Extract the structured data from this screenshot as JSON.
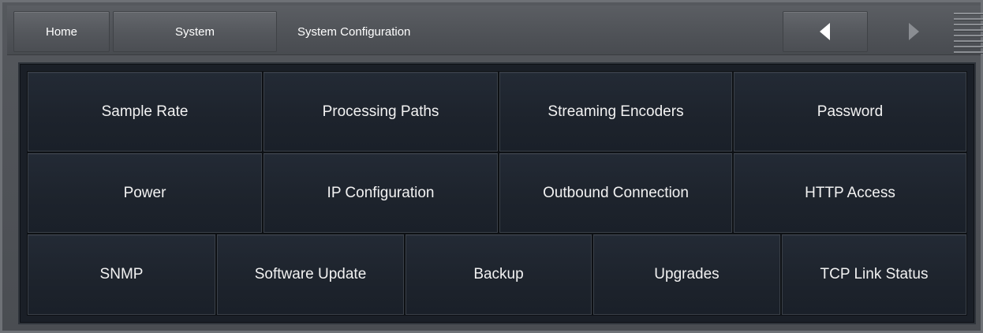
{
  "topbar": {
    "home_label": "Home",
    "system_label": "System",
    "title": "System Configuration",
    "back_icon": "triangle-left-icon",
    "forward_icon": "triangle-right-icon",
    "menu_icon": "hamburger-menu-icon"
  },
  "grid": {
    "row1": [
      "Sample Rate",
      "Processing Paths",
      "Streaming Encoders",
      "Password"
    ],
    "row2": [
      "Power",
      "IP Configuration",
      "Outbound Connection",
      "HTTP Access"
    ],
    "row3": [
      "SNMP",
      "Software Update",
      "Backup",
      "Upgrades",
      "TCP Link Status"
    ]
  },
  "colors": {
    "panel_bg": "#1a1f27",
    "chrome_bg": "#4f5257",
    "text": "#ffffff"
  }
}
